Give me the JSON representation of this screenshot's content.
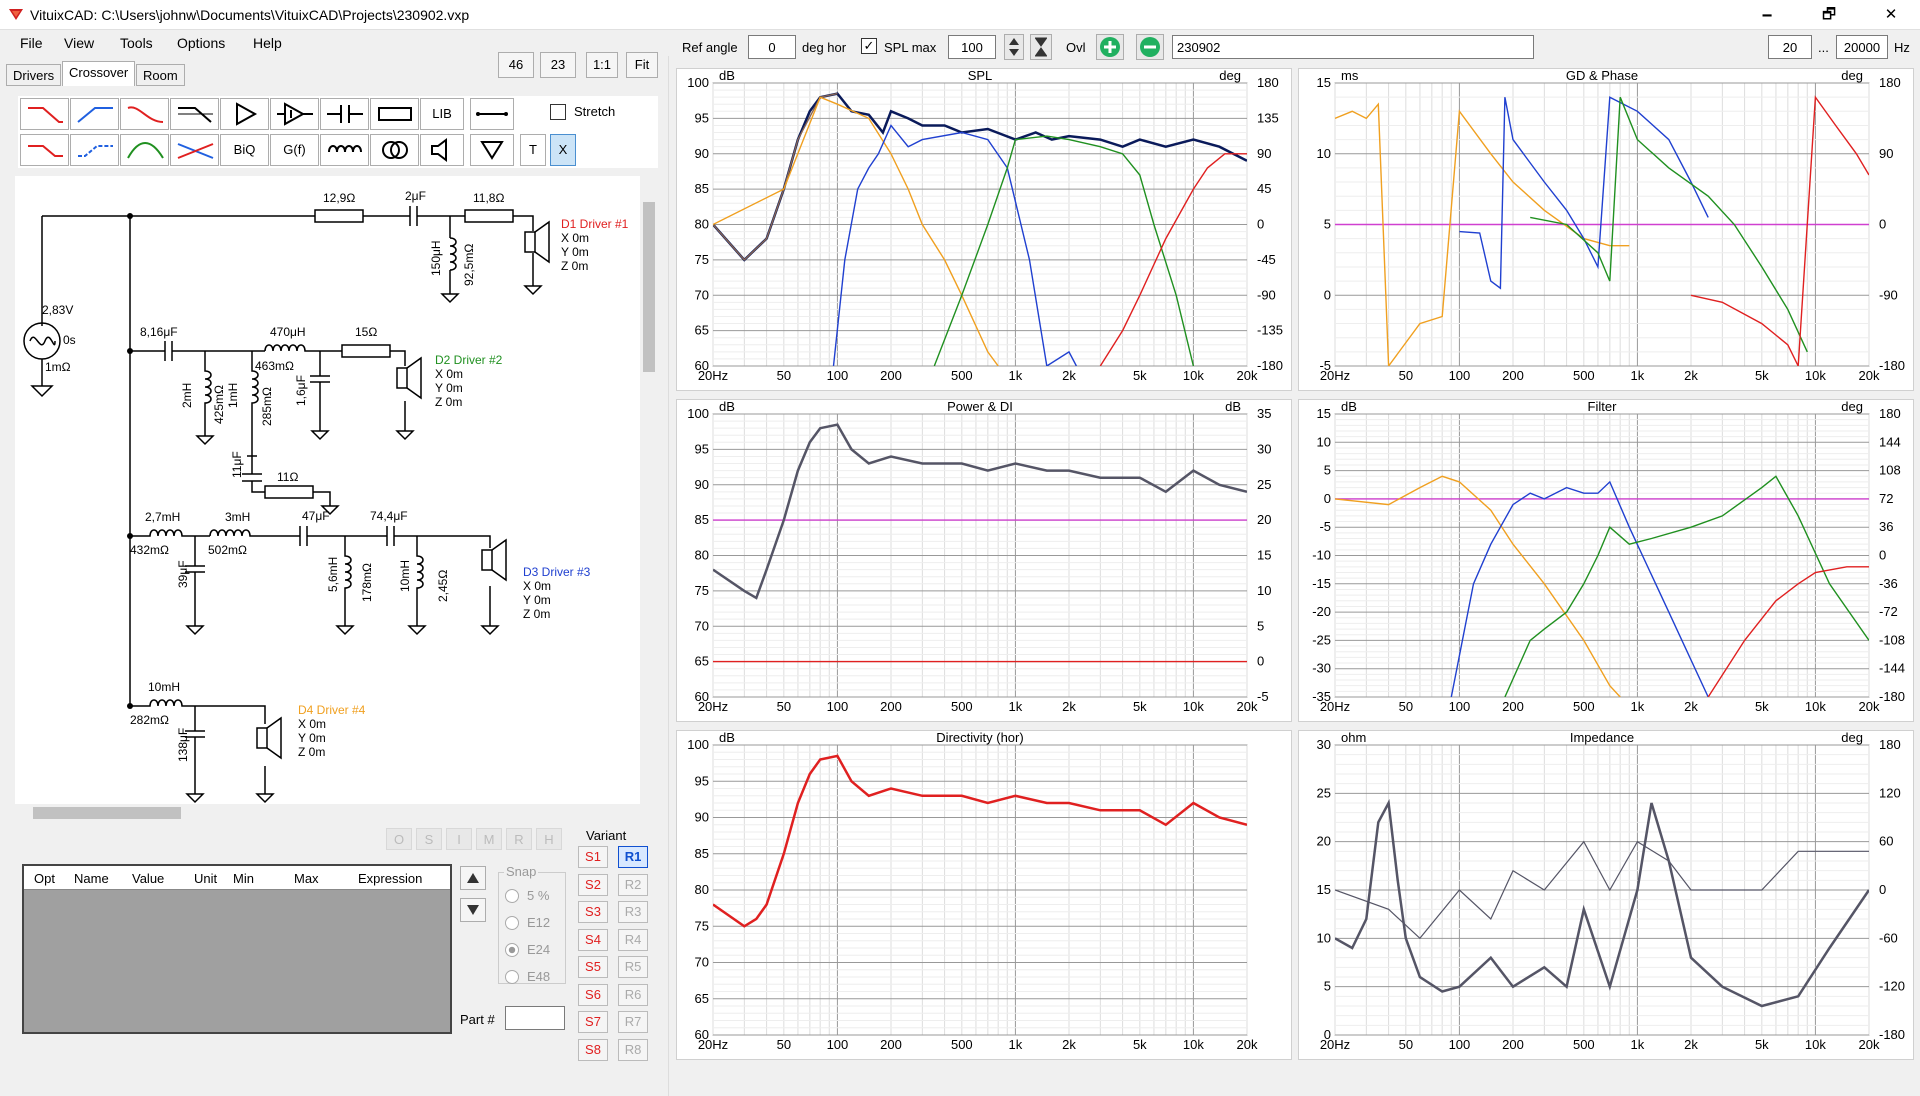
{
  "window": {
    "title": "VituixCAD: C:\\Users\\johnw\\Documents\\VituixCAD\\Projects\\230902.vxp",
    "minimize": "🗕",
    "maximize": "🗗",
    "close": "✕"
  },
  "menu": [
    "File",
    "View",
    "Tools",
    "Options",
    "Help"
  ],
  "tabs": [
    "Drivers",
    "Crossover",
    "Room"
  ],
  "zoom_buttons": [
    "46",
    "23",
    "1:1",
    "Fit"
  ],
  "toolbar": {
    "row1": [
      "",
      "",
      "",
      "",
      "",
      "",
      "",
      "",
      "LIB",
      ""
    ],
    "row2": [
      "",
      "",
      "",
      "",
      "BiQ",
      "G(f)",
      "",
      "",
      "",
      ""
    ],
    "stretch_label": "Stretch",
    "t_label": "T",
    "x_label": "X"
  },
  "top_controls": {
    "ref_angle_label": "Ref angle",
    "ref_angle_value": "0",
    "deg_hor_label": "deg hor",
    "spl_max_label": "SPL max",
    "spl_max_value": "100",
    "ovl_label": "Ovl",
    "ovl_name": "230902",
    "freq_min": "20",
    "ellipsis": "...",
    "freq_max": "20000",
    "hz_label": "Hz"
  },
  "schematic": {
    "source": {
      "voltage": "2,83V",
      "delay": "0s",
      "resistance": "1mΩ"
    },
    "drivers": [
      {
        "name": "D1 Driver #1",
        "x": "X 0m",
        "y": "Y 0m",
        "z": "Z 0m",
        "color": "#e02020"
      },
      {
        "name": "D2 Driver #2",
        "x": "X 0m",
        "y": "Y 0m",
        "z": "Z 0m",
        "color": "#209020"
      },
      {
        "name": "D3 Driver #3",
        "x": "X 0m",
        "y": "Y 0m",
        "z": "Z 0m",
        "color": "#2040d0"
      },
      {
        "name": "D4 Driver #4",
        "x": "X 0m",
        "y": "Y 0m",
        "z": "Z 0m",
        "color": "#f0a020"
      }
    ],
    "labels": {
      "r1": "12,9Ω",
      "c1": "2μF",
      "r2": "11,8Ω",
      "l1": "150μH",
      "l1r": "92,5mΩ",
      "c2": "8,16μF",
      "l2": "470μH",
      "l2r": "463mΩ",
      "r3": "15Ω",
      "l3": "2mH",
      "l3r": "425mΩ",
      "l4": "1mH",
      "l4r": "285mΩ",
      "c3": "1,6μF",
      "c4": "11μF",
      "r4": "11Ω",
      "l5": "2,7mH",
      "l5r": "432mΩ",
      "l6": "3mH",
      "l6r": "502mΩ",
      "c5": "47μF",
      "c6": "74,4μF",
      "c7": "39μF",
      "l7": "5,6mH",
      "l7r": "178mΩ",
      "l8": "10mH",
      "l8r": "2,45Ω",
      "l9": "10mH",
      "l9r": "282mΩ",
      "c8": "138μF"
    }
  },
  "opt_buttons": [
    "O",
    "S",
    "I",
    "M",
    "R",
    "H"
  ],
  "param_table": {
    "columns": [
      "Opt",
      "Name",
      "Value",
      "Unit",
      "Min",
      "Max",
      "Expression"
    ]
  },
  "snap": {
    "title": "Snap",
    "options": [
      "5 %",
      "E12",
      "E24",
      "E48"
    ],
    "selected": "E24"
  },
  "part_label": "Part #",
  "variant": {
    "title": "Variant",
    "s": [
      "S1",
      "S2",
      "S3",
      "S4",
      "S5",
      "S6",
      "S7",
      "S8"
    ],
    "r": [
      "R1",
      "R2",
      "R3",
      "R4",
      "R5",
      "R6",
      "R7",
      "R8"
    ],
    "selected": "R1"
  },
  "colors": {
    "red": "#e02020",
    "blue": "#2040d0",
    "green": "#209020",
    "orange": "#f0a020",
    "navy": "#0a1a5a",
    "magenta": "#d040d0",
    "gray": "#555566",
    "brown": "#886655"
  },
  "chart_data": [
    {
      "title": "SPL",
      "type": "line",
      "yunit": "dB",
      "y2unit": "deg",
      "ylim": [
        60,
        100
      ],
      "y2lim": [
        -180,
        180
      ],
      "xlim": [
        20,
        20000
      ],
      "xscale": "log",
      "yticks": [
        "100",
        "95",
        "90",
        "85",
        "80",
        "75",
        "70",
        "65",
        "60"
      ],
      "y2ticks": [
        "180",
        "135",
        "90",
        "45",
        "0",
        "-45",
        "-90",
        "-135",
        "-180"
      ],
      "xticks": [
        "20Hz",
        "50",
        "100",
        "200",
        "500",
        "1k",
        "2k",
        "5k",
        "10k",
        "20k"
      ],
      "series": [
        {
          "color": "navy",
          "x": [
            20,
            30,
            40,
            50,
            60,
            70,
            80,
            100,
            120,
            150,
            180,
            200,
            250,
            300,
            400,
            500,
            700,
            1000,
            1300,
            1600,
            2000,
            3000,
            4000,
            5000,
            7000,
            10000,
            14000,
            20000
          ],
          "y": [
            80,
            75,
            78,
            85,
            92,
            96,
            98,
            98.5,
            96,
            95.5,
            93,
            96,
            95,
            94,
            94,
            93,
            93.5,
            92,
            93,
            92,
            92.5,
            92,
            91,
            92,
            91,
            92,
            91,
            89
          ]
        },
        {
          "color": "brown",
          "x": [
            20,
            30,
            40,
            50,
            60,
            80,
            100
          ],
          "y": [
            80,
            75,
            78,
            85,
            92,
            98,
            98.5
          ]
        },
        {
          "color": "orange",
          "x": [
            20,
            50,
            80,
            100,
            150,
            200,
            250,
            300,
            400,
            500,
            700,
            800
          ],
          "y": [
            80,
            85,
            98,
            97,
            95,
            90,
            85,
            80,
            75,
            70,
            62,
            60
          ]
        },
        {
          "color": "blue",
          "x": [
            95,
            110,
            130,
            150,
            170,
            200,
            250,
            300,
            500,
            700,
            900,
            1200,
            1500,
            2000,
            2200
          ],
          "y": [
            60,
            75,
            85,
            88,
            90,
            94,
            91,
            92,
            93,
            92,
            88,
            75,
            60,
            62,
            60
          ]
        },
        {
          "color": "green",
          "x": [
            350,
            500,
            700,
            900,
            1000,
            1500,
            2000,
            3000,
            4000,
            5000,
            6000,
            8000,
            10000
          ],
          "y": [
            60,
            70,
            80,
            88,
            92,
            92.5,
            92,
            91,
            90,
            87,
            80,
            70,
            60
          ]
        },
        {
          "color": "red",
          "x": [
            3000,
            4000,
            5000,
            7000,
            10000,
            12000,
            15000,
            20000
          ],
          "y": [
            60,
            65,
            70,
            78,
            85,
            88,
            90,
            90
          ]
        }
      ]
    },
    {
      "title": "GD & Phase",
      "type": "line",
      "yunit": "ms",
      "y2unit": "deg",
      "ylim": [
        -5,
        15
      ],
      "y2lim": [
        -180,
        180
      ],
      "xlim": [
        20,
        20000
      ],
      "xscale": "log",
      "yticks": [
        "15",
        "10",
        "5",
        "0",
        "-5"
      ],
      "y2ticks": [
        "180",
        "90",
        "0",
        "-90",
        "-180"
      ],
      "xticks": [
        "20Hz",
        "50",
        "100",
        "200",
        "500",
        "1k",
        "2k",
        "5k",
        "10k",
        "20k"
      ],
      "series": [
        {
          "color": "magenta",
          "x": [
            20,
            20000
          ],
          "y": [
            5,
            5
          ]
        },
        {
          "color": "orange",
          "x": [
            20,
            25,
            30,
            35,
            40,
            60,
            80,
            100,
            150,
            200,
            300,
            500,
            700,
            900
          ],
          "y": [
            12.5,
            13,
            12.5,
            13.5,
            -5,
            -2,
            -1.5,
            13,
            10,
            8,
            6,
            4,
            3.5,
            3.5
          ]
        },
        {
          "color": "blue",
          "x": [
            100,
            130,
            150,
            170,
            180,
            200,
            300,
            400,
            500,
            600,
            700,
            1000,
            1500,
            2000,
            2500
          ],
          "y": [
            4.5,
            4.4,
            1,
            0.5,
            14,
            11,
            8,
            6,
            4,
            2,
            14,
            13,
            11,
            8,
            5.5
          ]
        },
        {
          "color": "green",
          "x": [
            250,
            400,
            600,
            700,
            800,
            1000,
            1500,
            2500,
            3500,
            5000,
            7000,
            9000
          ],
          "y": [
            5.5,
            5,
            3,
            1,
            14,
            11,
            9,
            7,
            5,
            2,
            -1,
            -4
          ]
        },
        {
          "color": "red",
          "x": [
            2000,
            3000,
            5000,
            7000,
            8000,
            10000,
            13000,
            17000,
            20000
          ],
          "y": [
            0,
            -0.5,
            -2,
            -3.5,
            -5,
            14,
            12,
            10,
            8.5
          ]
        }
      ]
    },
    {
      "title": "Power & DI",
      "type": "line",
      "yunit": "dB",
      "y2unit": "dB",
      "ylim": [
        60,
        100
      ],
      "y2lim": [
        -5,
        35
      ],
      "xlim": [
        20,
        20000
      ],
      "xscale": "log",
      "yticks": [
        "100",
        "95",
        "90",
        "85",
        "80",
        "75",
        "70",
        "65",
        "60"
      ],
      "y2ticks": [
        "35",
        "30",
        "25",
        "20",
        "15",
        "10",
        "5",
        "0",
        "-5"
      ],
      "xticks": [
        "20Hz",
        "50",
        "100",
        "200",
        "500",
        "1k",
        "2k",
        "5k",
        "10k",
        "20k"
      ],
      "series": [
        {
          "color": "magenta",
          "x": [
            20,
            20000
          ],
          "y": [
            85,
            85
          ]
        },
        {
          "color": "red",
          "x": [
            20,
            20000
          ],
          "y": [
            65,
            65
          ]
        },
        {
          "color": "gray",
          "x": [
            20,
            30,
            35,
            40,
            50,
            60,
            70,
            80,
            100,
            120,
            150,
            200,
            300,
            500,
            700,
            1000,
            1500,
            2000,
            3000,
            5000,
            7000,
            10000,
            14000,
            20000
          ],
          "y": [
            78,
            75,
            74,
            78,
            85,
            92,
            96,
            98,
            98.5,
            95,
            93,
            94,
            93,
            93,
            92,
            93,
            92,
            92,
            91,
            91,
            89,
            92,
            90,
            89
          ]
        }
      ]
    },
    {
      "title": "Filter",
      "type": "line",
      "yunit": "dB",
      "y2unit": "deg",
      "ylim": [
        -35,
        15
      ],
      "y2lim": [
        -180,
        180
      ],
      "xlim": [
        20,
        20000
      ],
      "xscale": "log",
      "yticks": [
        "15",
        "10",
        "5",
        "0",
        "-5",
        "-10",
        "-15",
        "-20",
        "-25",
        "-30",
        "-35"
      ],
      "y2ticks": [
        "180",
        "144",
        "108",
        "72",
        "36",
        "0",
        "-36",
        "-72",
        "-108",
        "-144",
        "-180"
      ],
      "xticks": [
        "20Hz",
        "50",
        "100",
        "200",
        "500",
        "1k",
        "2k",
        "5k",
        "10k",
        "20k"
      ],
      "series": [
        {
          "color": "magenta",
          "x": [
            20,
            20000
          ],
          "y": [
            0,
            0
          ]
        },
        {
          "color": "orange",
          "x": [
            20,
            40,
            60,
            80,
            100,
            150,
            200,
            300,
            500,
            700,
            800
          ],
          "y": [
            0,
            -1,
            2,
            4,
            3,
            -2,
            -8,
            -15,
            -25,
            -33,
            -35
          ]
        },
        {
          "color": "blue",
          "x": [
            90,
            120,
            150,
            200,
            250,
            300,
            400,
            500,
            600,
            700,
            900,
            1500,
            2500
          ],
          "y": [
            -35,
            -15,
            -8,
            -1,
            1,
            0,
            2,
            1,
            1,
            3,
            -5,
            -20,
            -35
          ]
        },
        {
          "color": "green",
          "x": [
            180,
            250,
            300,
            400,
            500,
            600,
            700,
            900,
            1200,
            2000,
            3000,
            5000,
            6000,
            8000,
            12000,
            20000
          ],
          "y": [
            -35,
            -25,
            -23,
            -20,
            -15,
            -10,
            -5,
            -8,
            -7,
            -5,
            -3,
            2,
            4,
            -3,
            -15,
            -25
          ]
        },
        {
          "color": "red",
          "x": [
            2500,
            4000,
            6000,
            8000,
            10000,
            15000,
            20000
          ],
          "y": [
            -35,
            -25,
            -18,
            -15,
            -13,
            -12,
            -12
          ]
        }
      ]
    },
    {
      "title": "Directivity (hor)",
      "type": "line",
      "yunit": "dB",
      "ylim": [
        60,
        100
      ],
      "xlim": [
        20,
        20000
      ],
      "xscale": "log",
      "yticks": [
        "100",
        "95",
        "90",
        "85",
        "80",
        "75",
        "70",
        "65",
        "60"
      ],
      "xticks": [
        "20Hz",
        "50",
        "100",
        "200",
        "500",
        "1k",
        "2k",
        "5k",
        "10k",
        "20k"
      ],
      "series": [
        {
          "color": "red",
          "x": [
            20,
            30,
            35,
            40,
            50,
            60,
            70,
            80,
            100,
            120,
            150,
            200,
            300,
            500,
            700,
            1000,
            1500,
            2000,
            3000,
            5000,
            7000,
            10000,
            14000,
            20000
          ],
          "y": [
            78,
            75,
            76,
            78,
            85,
            92,
            96,
            98,
            98.5,
            95,
            93,
            94,
            93,
            93,
            92,
            93,
            92,
            92,
            91,
            91,
            89,
            92,
            90,
            89
          ]
        }
      ]
    },
    {
      "title": "Impedance",
      "type": "line",
      "yunit": "ohm",
      "y2unit": "deg",
      "ylim": [
        0,
        30
      ],
      "y2lim": [
        -180,
        180
      ],
      "xlim": [
        20,
        20000
      ],
      "xscale": "log",
      "yticks": [
        "30",
        "25",
        "20",
        "15",
        "10",
        "5",
        "0"
      ],
      "y2ticks": [
        "180",
        "120",
        "60",
        "0",
        "-60",
        "-120",
        "-180"
      ],
      "xticks": [
        "20Hz",
        "50",
        "100",
        "200",
        "500",
        "1k",
        "2k",
        "5k",
        "10k",
        "20k"
      ],
      "series": [
        {
          "color": "gray",
          "x": [
            20,
            25,
            30,
            35,
            40,
            45,
            50,
            60,
            80,
            100,
            150,
            200,
            300,
            400,
            500,
            700,
            1000,
            1200,
            1500,
            2000,
            3000,
            5000,
            8000,
            12000,
            20000
          ],
          "y": [
            10,
            9,
            12,
            22,
            24,
            16,
            10,
            6,
            4.5,
            5,
            8,
            5,
            7,
            5,
            13,
            5,
            15,
            24,
            18,
            8,
            5,
            3,
            4,
            9,
            15
          ]
        },
        {
          "color": "gray",
          "x": [
            20,
            40,
            60,
            100,
            150,
            200,
            300,
            500,
            700,
            1000,
            1500,
            2000,
            3000,
            5000,
            8000,
            12000,
            20000
          ],
          "y": [
            15,
            13,
            10,
            15,
            12,
            17,
            15,
            20,
            15,
            20,
            18,
            15,
            15,
            15,
            19,
            19,
            19
          ]
        }
      ]
    }
  ]
}
